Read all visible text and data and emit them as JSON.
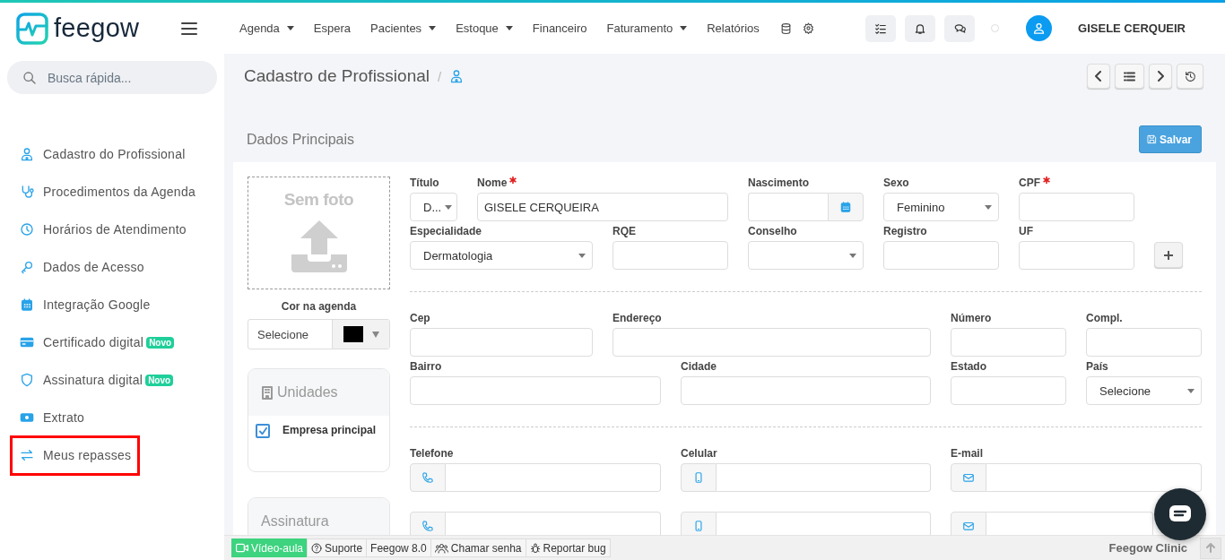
{
  "header": {
    "brand": "feegow",
    "nav": [
      {
        "label": "Agenda",
        "dropdown": true
      },
      {
        "label": "Espera",
        "dropdown": false
      },
      {
        "label": "Pacientes",
        "dropdown": true
      },
      {
        "label": "Estoque",
        "dropdown": true
      },
      {
        "label": "Financeiro",
        "dropdown": false
      },
      {
        "label": "Faturamento",
        "dropdown": true
      },
      {
        "label": "Relatórios",
        "dropdown": false
      }
    ],
    "user": "GISELE CERQUEIR"
  },
  "search": {
    "placeholder": "Busca rápida..."
  },
  "sidebar": {
    "items": [
      {
        "label": "Cadastro do Profissional",
        "highlighted": false
      },
      {
        "label": "Procedimentos da Agenda",
        "highlighted": false
      },
      {
        "label": "Horários de Atendimento",
        "highlighted": false
      },
      {
        "label": "Dados de Acesso",
        "highlighted": false
      },
      {
        "label": "Integração Google",
        "highlighted": false
      },
      {
        "label": "Certificado digital",
        "badge": "Novo",
        "highlighted": false
      },
      {
        "label": "Assinatura digital",
        "badge": "Novo",
        "highlighted": false
      },
      {
        "label": "Extrato",
        "highlighted": false
      },
      {
        "label": "Meus repasses",
        "highlighted": true
      }
    ]
  },
  "page": {
    "title": "Cadastro de Profissional",
    "separator": "/"
  },
  "card": {
    "title": "Dados Principais",
    "save_button": "Salvar",
    "photo": {
      "text": "Sem foto"
    },
    "agenda_color": {
      "label": "Cor na agenda",
      "value": "Selecione",
      "color": "#000000"
    },
    "units": {
      "title": "Unidades",
      "items": [
        {
          "label": "Empresa principal",
          "checked": true
        }
      ]
    },
    "signature": {
      "title": "Assinatura"
    },
    "sections": [
      {
        "rows": [
          [
            {
              "label": "Título",
              "kind": "select",
              "value": "D..."
            },
            {
              "label": "Nome",
              "required": true,
              "kind": "text",
              "value": "GISELE CERQUEIRA"
            },
            {
              "label": "Nascimento",
              "kind": "date"
            },
            {
              "label": "Sexo",
              "kind": "select",
              "value": "Feminino"
            },
            {
              "label": "CPF",
              "required": true,
              "kind": "text"
            }
          ],
          [
            {
              "label": "Especialidade",
              "kind": "select",
              "value": "Dermatologia"
            },
            {
              "label": "RQE",
              "kind": "text"
            },
            {
              "label": "Conselho",
              "kind": "select"
            },
            {
              "label": "Registro",
              "kind": "text"
            },
            {
              "label": "UF",
              "kind": "text"
            },
            {
              "kind": "add"
            }
          ]
        ]
      },
      {
        "rows": [
          [
            {
              "label": "Cep",
              "kind": "text"
            },
            {
              "label": "Endereço",
              "kind": "text"
            },
            {
              "label": "Número",
              "kind": "text"
            },
            {
              "label": "Compl.",
              "kind": "text"
            }
          ],
          [
            {
              "label": "Bairro",
              "kind": "text"
            },
            {
              "label": "Cidade",
              "kind": "text"
            },
            {
              "label": "Estado",
              "kind": "text"
            },
            {
              "label": "País",
              "kind": "select",
              "value": "Selecione"
            }
          ]
        ]
      },
      {
        "rows": [
          [
            {
              "label": "Telefone",
              "kind": "phone"
            },
            {
              "label": "Celular",
              "kind": "mobile"
            },
            {
              "label": "E-mail",
              "kind": "email"
            }
          ],
          [
            {
              "kind": "phone"
            },
            {
              "kind": "mobile"
            },
            {
              "kind": "email"
            }
          ]
        ]
      }
    ]
  },
  "footer": {
    "buttons": [
      {
        "label": "Vídeo-aula",
        "kind": "video"
      },
      {
        "label": "Suporte",
        "kind": "help"
      },
      {
        "label": "Feegow 8.0",
        "kind": "plain"
      },
      {
        "label": "Chamar senha",
        "kind": "users"
      },
      {
        "label": "Reportar bug",
        "kind": "bug"
      }
    ],
    "brand": "Feegow Clinic"
  }
}
